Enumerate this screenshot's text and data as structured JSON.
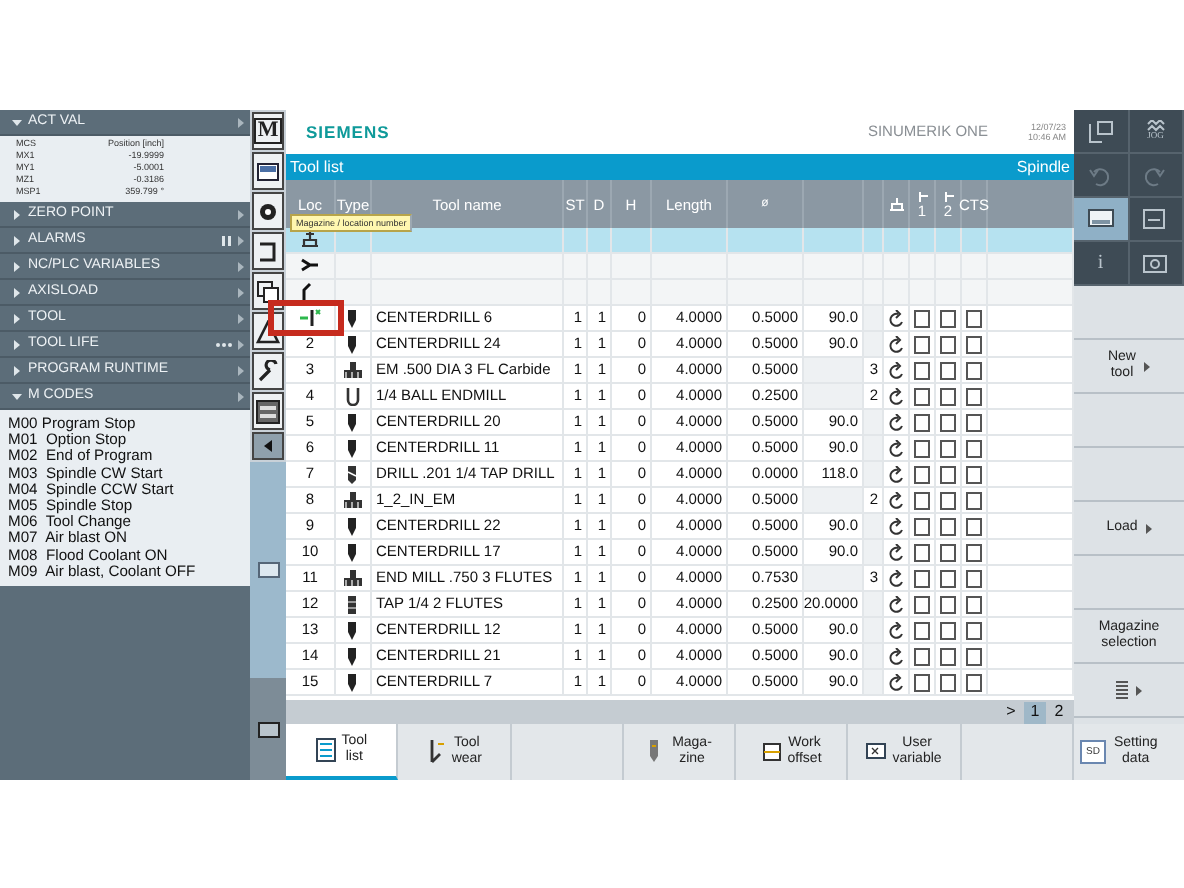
{
  "left_panel": {
    "sections": [
      {
        "title": "ACT VAL",
        "expanded": true,
        "table": {
          "columns": [
            "MCS",
            "Position [inch]"
          ],
          "rows": [
            [
              "MX1",
              "-19.9999"
            ],
            [
              "MY1",
              "-5.0001"
            ],
            [
              "MZ1",
              "-0.3186"
            ],
            [
              "MSP1",
              "359.799 °"
            ]
          ]
        }
      },
      {
        "title": "ZERO POINT",
        "expanded": false
      },
      {
        "title": "ALARMS",
        "expanded": false
      },
      {
        "title": "NC/PLC VARIABLES",
        "expanded": false
      },
      {
        "title": "AXISLOAD",
        "expanded": false
      },
      {
        "title": "TOOL",
        "expanded": false
      },
      {
        "title": "TOOL LIFE",
        "expanded": false
      },
      {
        "title": "PROGRAM RUNTIME",
        "expanded": false
      },
      {
        "title": "M CODES",
        "expanded": true,
        "lines": [
          "M00 Program Stop",
          "M01  Option Stop",
          "M02  End of Program",
          "M03  Spindle CW Start",
          "M04  Spindle CCW Start",
          "M05  Spindle Stop",
          "M06  Tool Change",
          "M07  Air blast ON",
          "M08  Flood Coolant ON",
          "M09  Air blast, Coolant OFF"
        ]
      }
    ]
  },
  "side_toolbar": {
    "logo_letter": "M"
  },
  "header": {
    "brand": "SIEMENS",
    "product": "SINUMERIK ONE",
    "date": "12/07/23",
    "time": "10:46 AM"
  },
  "tool_list": {
    "title": "Tool list",
    "spindle_label": "Spindle",
    "columns": [
      "Loc",
      "Type",
      "Tool name",
      "ST",
      "D",
      "H",
      "Length",
      "ø",
      "1",
      "2",
      "CTS"
    ],
    "tooltip": "Magazine / location number",
    "special_rows": [
      {
        "kind": "spindle",
        "selected": true
      },
      {
        "kind": "gripper",
        "selected": false
      },
      {
        "kind": "gripper2",
        "selected": false
      }
    ],
    "rows": [
      {
        "kind": "centerdrill",
        "name": "CENTERDRILL 6",
        "st": "1",
        "d": "1",
        "h": "0",
        "length": "4.0000",
        "dia": "0.5000",
        "angle": "90.0",
        "flutes": "",
        "checks": [
          false,
          false,
          false
        ],
        "highlighted": true
      },
      {
        "loc": "2",
        "kind": "centerdrill",
        "name": "CENTERDRILL 24",
        "st": "1",
        "d": "1",
        "h": "0",
        "length": "4.0000",
        "dia": "0.5000",
        "angle": "90.0",
        "flutes": "",
        "checks": [
          false,
          false,
          false
        ],
        "highlighted": false
      },
      {
        "loc": "3",
        "kind": "endmill",
        "name": "EM .500 DIA 3 FL Carbide",
        "st": "1",
        "d": "1",
        "h": "0",
        "length": "4.0000",
        "dia": "0.5000",
        "angle": "",
        "flutes": "3",
        "checks": [
          false,
          false,
          false
        ],
        "highlighted": false
      },
      {
        "loc": "4",
        "kind": "ballmill",
        "name": "1/4 BALL ENDMILL",
        "st": "1",
        "d": "1",
        "h": "0",
        "length": "4.0000",
        "dia": "0.2500",
        "angle": "",
        "flutes": "2",
        "checks": [
          false,
          false,
          false
        ],
        "highlighted": false
      },
      {
        "loc": "5",
        "kind": "centerdrill",
        "name": "CENTERDRILL 20",
        "st": "1",
        "d": "1",
        "h": "0",
        "length": "4.0000",
        "dia": "0.5000",
        "angle": "90.0",
        "flutes": "",
        "checks": [
          false,
          false,
          false
        ],
        "highlighted": false
      },
      {
        "loc": "6",
        "kind": "centerdrill",
        "name": "CENTERDRILL 11",
        "st": "1",
        "d": "1",
        "h": "0",
        "length": "4.0000",
        "dia": "0.5000",
        "angle": "90.0",
        "flutes": "",
        "checks": [
          false,
          false,
          false
        ],
        "highlighted": false
      },
      {
        "loc": "7",
        "kind": "drill",
        "name": "DRILL .201 1/4 TAP DRILL",
        "st": "1",
        "d": "1",
        "h": "0",
        "length": "4.0000",
        "dia": "0.0000",
        "angle": "118.0",
        "flutes": "",
        "checks": [
          false,
          false,
          false
        ],
        "highlighted": false
      },
      {
        "loc": "8",
        "kind": "endmill",
        "name": "1_2_IN_EM",
        "st": "1",
        "d": "1",
        "h": "0",
        "length": "4.0000",
        "dia": "0.5000",
        "angle": "",
        "flutes": "2",
        "checks": [
          false,
          false,
          false
        ],
        "highlighted": false
      },
      {
        "loc": "9",
        "kind": "centerdrill",
        "name": "CENTERDRILL 22",
        "st": "1",
        "d": "1",
        "h": "0",
        "length": "4.0000",
        "dia": "0.5000",
        "angle": "90.0",
        "flutes": "",
        "checks": [
          false,
          false,
          false
        ],
        "highlighted": false
      },
      {
        "loc": "10",
        "kind": "centerdrill",
        "name": "CENTERDRILL 17",
        "st": "1",
        "d": "1",
        "h": "0",
        "length": "4.0000",
        "dia": "0.5000",
        "angle": "90.0",
        "flutes": "",
        "checks": [
          false,
          false,
          false
        ],
        "highlighted": false
      },
      {
        "loc": "11",
        "kind": "endmill",
        "name": "END MILL .750 3 FLUTES",
        "st": "1",
        "d": "1",
        "h": "0",
        "length": "4.0000",
        "dia": "0.7530",
        "angle": "",
        "flutes": "3",
        "checks": [
          false,
          false,
          false
        ],
        "highlighted": false
      },
      {
        "loc": "12",
        "kind": "tap",
        "name": "TAP 1/4 2 FLUTES",
        "st": "1",
        "d": "1",
        "h": "0",
        "length": "4.0000",
        "dia": "0.2500",
        "angle": "20.0000",
        "flutes": "",
        "checks": [
          false,
          false,
          false
        ],
        "highlighted": false
      },
      {
        "loc": "13",
        "kind": "centerdrill",
        "name": "CENTERDRILL 12",
        "st": "1",
        "d": "1",
        "h": "0",
        "length": "4.0000",
        "dia": "0.5000",
        "angle": "90.0",
        "flutes": "",
        "checks": [
          false,
          false,
          false
        ],
        "highlighted": false
      },
      {
        "loc": "14",
        "kind": "centerdrill",
        "name": "CENTERDRILL 21",
        "st": "1",
        "d": "1",
        "h": "0",
        "length": "4.0000",
        "dia": "0.5000",
        "angle": "90.0",
        "flutes": "",
        "checks": [
          false,
          false,
          false
        ],
        "highlighted": false
      },
      {
        "loc": "15",
        "kind": "centerdrill",
        "name": "CENTERDRILL 7",
        "st": "1",
        "d": "1",
        "h": "0",
        "length": "4.0000",
        "dia": "0.5000",
        "angle": "90.0",
        "flutes": "",
        "checks": [
          false,
          false,
          false
        ],
        "highlighted": false
      }
    ],
    "pages": [
      {
        "label": ">",
        "selected": false
      },
      {
        "label": "1",
        "selected": true
      },
      {
        "label": "2",
        "selected": false
      }
    ]
  },
  "bottom_softkeys": [
    {
      "lines": [
        "Tool",
        "list"
      ],
      "selected": true
    },
    {
      "lines": [
        "Tool",
        "wear"
      ],
      "selected": false
    },
    {
      "selected": false
    },
    {
      "lines": [
        "Maga-",
        "zine"
      ],
      "selected": false
    },
    {
      "lines": [
        "Work",
        "offset"
      ],
      "selected": false
    },
    {
      "lines": [
        "User",
        "variable"
      ],
      "selected": false
    },
    {
      "selected": false
    }
  ],
  "right_panel": {
    "icon_buttons": [
      {
        "selected": false
      },
      {
        "label": "JOG",
        "selected": false
      },
      {
        "selected": false
      },
      {
        "selected": false
      },
      {
        "selected": true
      },
      {
        "selected": false
      },
      {
        "label": "i",
        "selected": false
      },
      {
        "selected": false
      }
    ],
    "softkeys": [
      {
        "arrow": false
      },
      {
        "lines": [
          "New",
          "tool"
        ],
        "arrow": true
      },
      {
        "arrow": false
      },
      {
        "arrow": false
      },
      {
        "lines": [
          "Load"
        ],
        "arrow": true
      },
      {
        "arrow": false
      },
      {
        "lines": [
          "Magazine",
          "selection"
        ],
        "arrow": false
      },
      {
        "arrow": true
      }
    ],
    "bottom": {
      "lines": [
        "Setting",
        "data"
      ],
      "badge": "SD"
    }
  }
}
